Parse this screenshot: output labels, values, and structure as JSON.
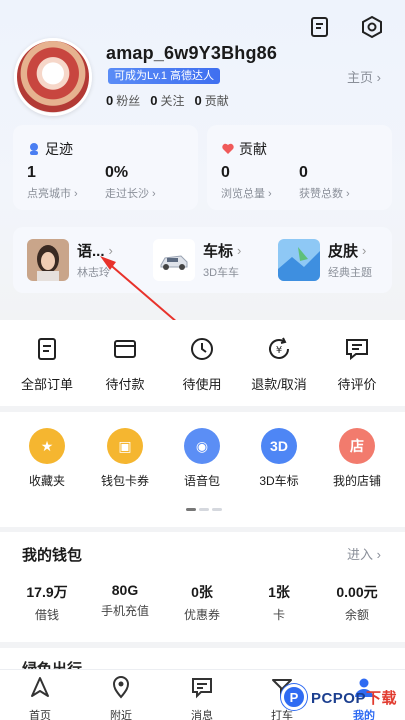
{
  "profile": {
    "username": "amap_6w9Y3Bhg86",
    "level_badge": "可成为Lv.1 高德达人",
    "homepage_link": "主页 ›",
    "stats": [
      {
        "value": "0",
        "label": "粉丝"
      },
      {
        "value": "0",
        "label": "关注"
      },
      {
        "value": "0",
        "label": "贡献"
      }
    ]
  },
  "footprint": {
    "title": "足迹",
    "metrics": [
      {
        "value": "1",
        "label": "点亮城市 ›"
      },
      {
        "value": "0%",
        "label": "走过长沙 ›"
      }
    ]
  },
  "contribution": {
    "title": "贡献",
    "metrics": [
      {
        "value": "0",
        "label": "浏览总量 ›"
      },
      {
        "value": "0",
        "label": "获赞总数 ›"
      }
    ]
  },
  "features": [
    {
      "title": "语...",
      "subtitle": "林志玲"
    },
    {
      "title": "车标",
      "subtitle": "3D车车"
    },
    {
      "title": "皮肤",
      "subtitle": "经典主题"
    }
  ],
  "orders": [
    "全部订单",
    "待付款",
    "待使用",
    "退款/取消",
    "待评价"
  ],
  "tools": [
    {
      "label": "收藏夹",
      "color": "#f5b630",
      "glyph": "★"
    },
    {
      "label": "钱包卡券",
      "color": "#f5b630",
      "glyph": "▣"
    },
    {
      "label": "语音包",
      "color": "#5b8ef5",
      "glyph": "◉"
    },
    {
      "label": "3D车标",
      "color": "#4e86f5",
      "glyph": "3D"
    },
    {
      "label": "我的店铺",
      "color": "#f27b6d",
      "glyph": "店"
    }
  ],
  "wallet": {
    "title": "我的钱包",
    "enter": "进入 ›",
    "items": [
      {
        "value": "17.9万",
        "label": "借钱"
      },
      {
        "value": "80G",
        "label": "手机充值"
      },
      {
        "value": "0张",
        "label": "优惠券"
      },
      {
        "value": "1张",
        "label": "卡"
      },
      {
        "value": "0.00元",
        "label": "余额"
      }
    ]
  },
  "peek_title": "绿色出行",
  "tabs": [
    "首页",
    "附近",
    "消息",
    "打车",
    "我的"
  ],
  "watermark": {
    "circle": "P",
    "brand": "PCPOP",
    "suffix": "下载"
  }
}
